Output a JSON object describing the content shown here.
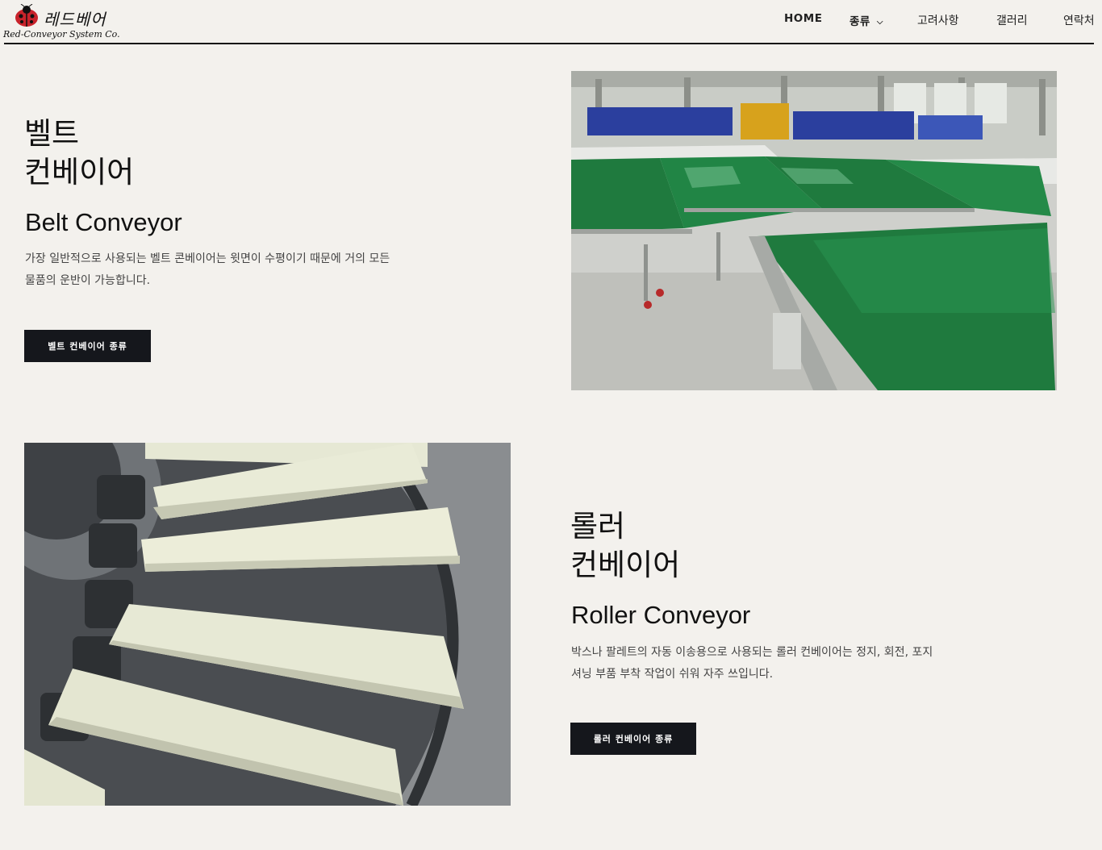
{
  "brand": {
    "name": "레드베어",
    "tagline": "Red-Conveyor System Co."
  },
  "nav": {
    "items": [
      {
        "label": "HOME"
      },
      {
        "label": "종류"
      },
      {
        "label": "고려사항"
      },
      {
        "label": "갤러리"
      },
      {
        "label": "연락처"
      }
    ]
  },
  "belt": {
    "title_line1": "벨트",
    "title_line2": "컨베이어",
    "subtitle": "Belt Conveyor",
    "desc_line1": "가장 일반적으로 사용되는 벨트 콘베이어는 윗면이 수평이기 때문에 거의 모든",
    "desc_line2": "물품의 운반이 가능합니다.",
    "button": "벨트 컨베이어 종류",
    "image": "green-belt-conveyor-photo"
  },
  "roller": {
    "title_line1": "롤러",
    "title_line2": "컨베이어",
    "subtitle": "Roller Conveyor",
    "desc_line1": "박스나 팔레트의 자동 이송용으로 사용되는 롤러 컨베이어는 정지, 회전, 포지",
    "desc_line2": "셔닝 부품 부착 작업이 쉬워 자주 쓰입니다.",
    "button": "롤러 컨베이어 종류",
    "image": "tapered-roller-conveyor-photo"
  },
  "colors": {
    "background": "#f3f1ed",
    "button": "#15171c",
    "accent_red": "#d0202a",
    "belt_green": "#1f7a3e"
  }
}
